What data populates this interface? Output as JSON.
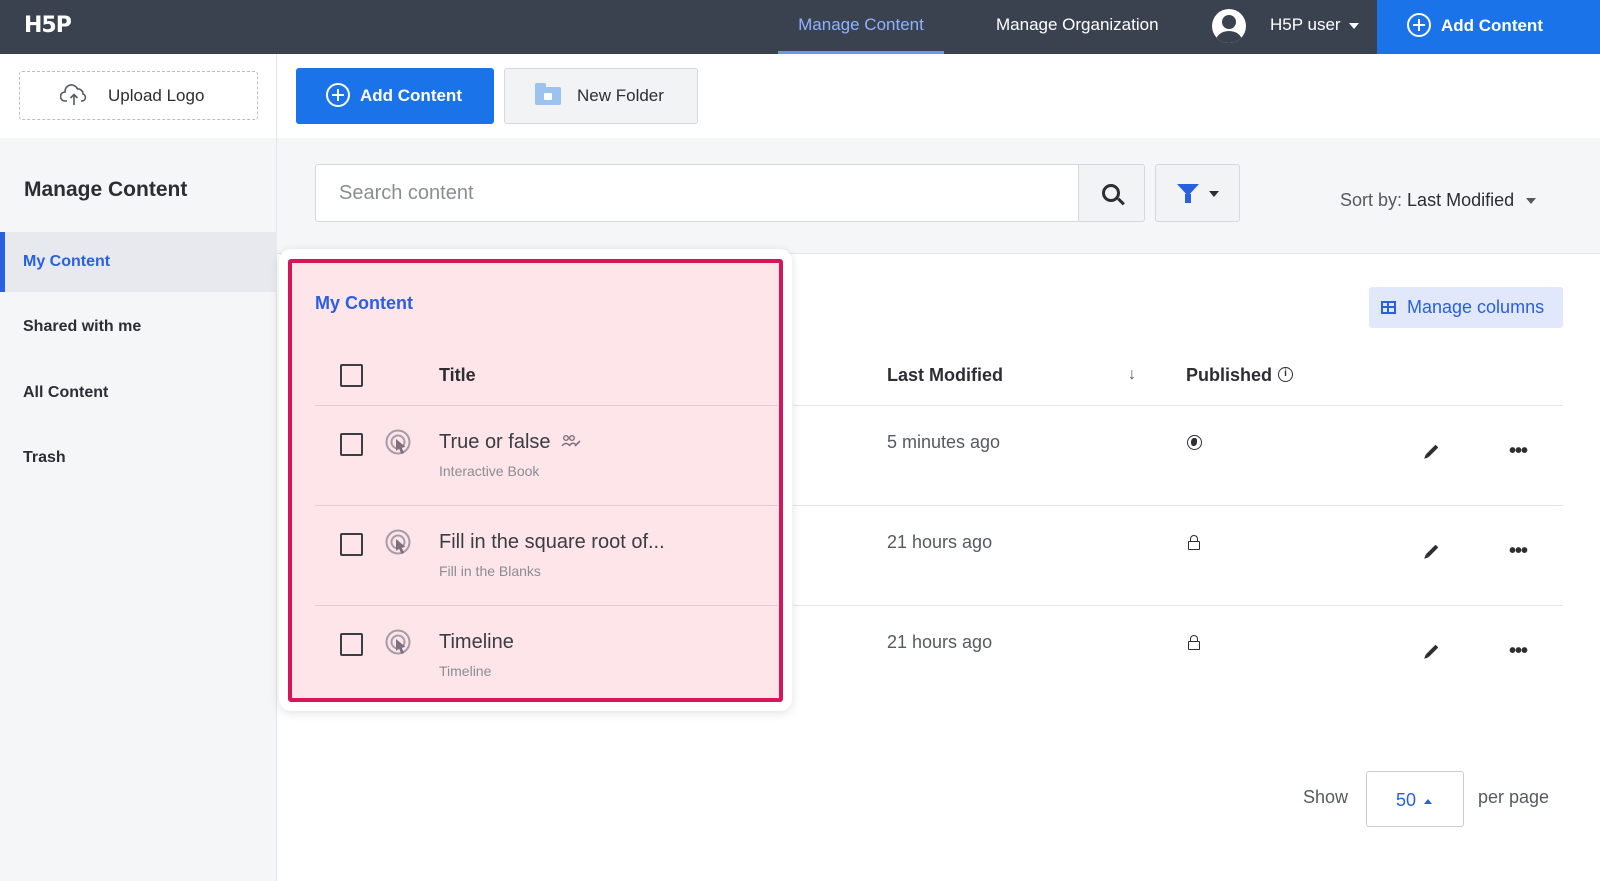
{
  "app": {
    "logo": "H5P"
  },
  "topnav": {
    "manage_content": "Manage Content",
    "manage_organization": "Manage Organization",
    "user": "H5P user",
    "add_content": "Add Content"
  },
  "logo_panel": {
    "upload_logo": "Upload Logo"
  },
  "toolbar": {
    "add_content": "Add Content",
    "new_folder": "New Folder"
  },
  "sidebar": {
    "title": "Manage Content",
    "items": [
      {
        "label": "My Content",
        "active": true
      },
      {
        "label": "Shared with me",
        "active": false
      },
      {
        "label": "All Content",
        "active": false
      },
      {
        "label": "Trash",
        "active": false
      }
    ]
  },
  "search": {
    "placeholder": "Search content"
  },
  "sort": {
    "label": "Sort by:",
    "value": "Last Modified"
  },
  "table": {
    "section_title": "My Content",
    "manage_columns": "Manage columns",
    "columns": {
      "title": "Title",
      "last_modified": "Last Modified",
      "published": "Published"
    },
    "rows": [
      {
        "title": "True or false",
        "type": "Interactive Book",
        "modified": "5 minutes ago",
        "published_icon": "globe-icon",
        "shared": true
      },
      {
        "title": "Fill in the square root of...",
        "type": "Fill in the Blanks",
        "modified": "21 hours ago",
        "published_icon": "lock-icon",
        "shared": false
      },
      {
        "title": "Timeline",
        "type": "Timeline",
        "modified": "21 hours ago",
        "published_icon": "lock-icon",
        "shared": false
      }
    ]
  },
  "pagination": {
    "show": "Show",
    "per_page_value": "50",
    "per_page": "per page"
  },
  "colors": {
    "primary": "#1a73e8",
    "accent_link": "#2860e0",
    "topbar": "#3a414f",
    "highlight_border": "#d6155a",
    "highlight_fill": "#fde5ea"
  }
}
